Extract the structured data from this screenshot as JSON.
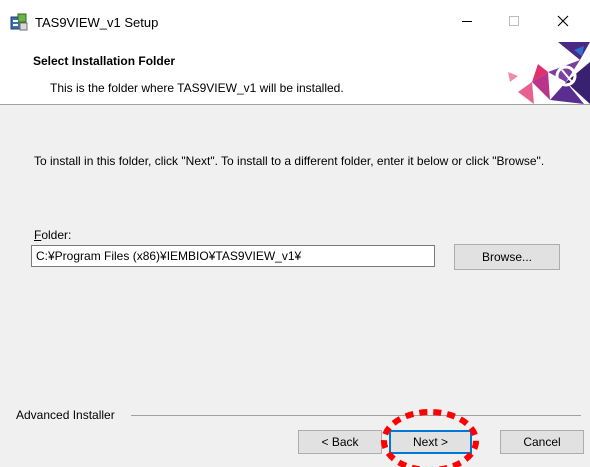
{
  "window": {
    "title": "TAS9VIEW_v1 Setup",
    "controls": {
      "minimize": "—",
      "maximize": "☐",
      "close": "✕"
    }
  },
  "header": {
    "title": "Select Installation Folder",
    "subtitle": "This is the folder where TAS9VIEW_v1 will be installed."
  },
  "body": {
    "instructions": "To install in this folder, click \"Next\". To install to a different folder, enter it below or click \"Browse\".",
    "folder_label_underlined": "F",
    "folder_label_rest": "older:",
    "folder_value": "C:¥Program Files (x86)¥IEMBIO¥TAS9VIEW_v1¥",
    "browse_label": "Browse..."
  },
  "footer": {
    "brand": "Advanced Installer",
    "back_label": "< Back",
    "next_label": "Next >",
    "cancel_label": "Cancel"
  },
  "colors": {
    "accent": "#0078d7",
    "highlight": "#ff0000",
    "logo_purple": "#4a2a82",
    "logo_pink": "#e0306a"
  }
}
